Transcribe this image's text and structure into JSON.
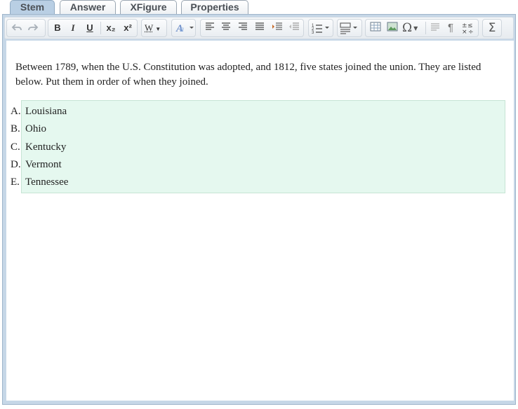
{
  "tabs": [
    {
      "label": "Stem",
      "active": true
    },
    {
      "label": "Answer",
      "active": false
    },
    {
      "label": "XFigure",
      "active": false
    },
    {
      "label": "Properties",
      "active": false
    }
  ],
  "toolbar": {
    "undo": "undo-icon",
    "redo": "redo-icon",
    "bold_label": "B",
    "italic_label": "I",
    "underline_label": "U",
    "subscript_label": "x₂",
    "superscript_label": "x²",
    "word_style_label": "W",
    "omega_label": "Ω",
    "pilcrow_label": "¶",
    "sigma_label": "Σ"
  },
  "question": {
    "stem": "Between 1789, when the U.S. Constitution was adopted, and 1812, five states joined the union. They are listed below. Put them in order of when they joined.",
    "choices": [
      {
        "letter": "A.",
        "text": "Louisiana"
      },
      {
        "letter": "B.",
        "text": "Ohio"
      },
      {
        "letter": "C.",
        "text": "Kentucky"
      },
      {
        "letter": "D.",
        "text": "Vermont"
      },
      {
        "letter": "E.",
        "text": "Tennessee"
      }
    ]
  },
  "colors": {
    "tab_active": "#b9cfe4",
    "frame": "#c6d7e7",
    "choices_bg": "#e5f8ef"
  }
}
